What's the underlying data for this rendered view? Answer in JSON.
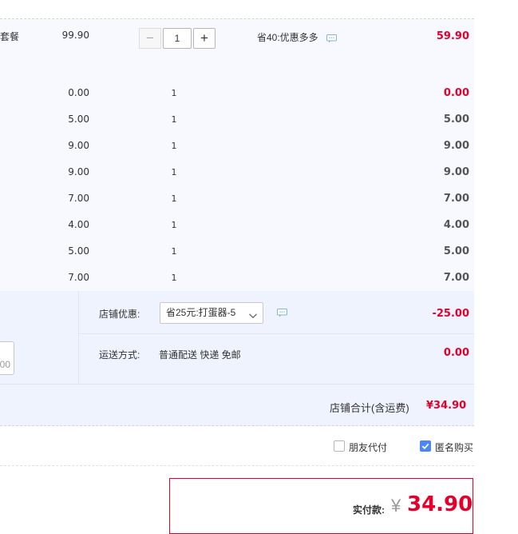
{
  "package": {
    "main_item": {
      "name": "套餐",
      "price": "99.90",
      "quantity": "1",
      "minus": "−",
      "plus": "+",
      "promo": "省40:优惠多多",
      "total": "59.90"
    },
    "items": [
      {
        "price": "0.00",
        "qty": "1",
        "total": "0.00"
      },
      {
        "price": "5.00",
        "qty": "1",
        "total": "5.00"
      },
      {
        "price": "9.00",
        "qty": "1",
        "total": "9.00"
      },
      {
        "price": "9.00",
        "qty": "1",
        "total": "9.00"
      },
      {
        "price": "7.00",
        "qty": "1",
        "total": "7.00"
      },
      {
        "price": "4.00",
        "qty": "1",
        "total": "4.00"
      },
      {
        "price": "5.00",
        "qty": "1",
        "total": "5.00"
      },
      {
        "price": "7.00",
        "qty": "1",
        "total": "7.00"
      }
    ]
  },
  "shop": {
    "discount_label": "店铺优惠:",
    "discount_selected": "省25元:打蛋器-5",
    "discount_amount": "-25.00",
    "shipping_label": "运送方式:",
    "shipping_method": "普通配送 快递 免邮",
    "shipping_fee": "0.00",
    "message_box_fragment": "00",
    "subtotal_label": "店铺合计(含运费)",
    "subtotal_value": "¥34.90"
  },
  "options": {
    "friend_pay": {
      "label": "朋友代付",
      "checked": false
    },
    "anonymous": {
      "label": "匿名购买",
      "checked": true
    }
  },
  "payment": {
    "label": "实付款:",
    "currency": "¥",
    "amount": "34.90"
  },
  "colors": {
    "accent_red": "#e4002b",
    "checkbox_blue": "#4d84f6",
    "package_bg": "#f7f9ff",
    "shop_bg": "#eef3fd"
  }
}
